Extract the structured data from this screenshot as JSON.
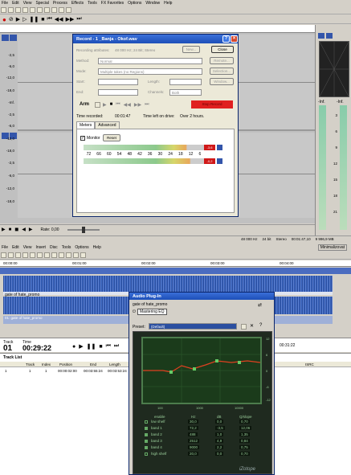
{
  "top": {
    "menu": [
      "File",
      "Edit",
      "View",
      "Special",
      "Process",
      "Effects",
      "Tools",
      "FX Favorites",
      "Options",
      "Window",
      "Help"
    ]
  },
  "scale_top": [
    "-2,5",
    "-6,0",
    "-12,0",
    "-18,0",
    "-Inf.",
    "-2,5",
    "-6,0",
    "-12,0",
    "-18,0",
    "-2,5",
    "-6,0",
    "-12,0",
    "-18,0"
  ],
  "meter_right": {
    "left": "-Inf.",
    "right": "-Inf.",
    "ticks": [
      "3",
      "6",
      "9",
      "12",
      "15",
      "18",
      "21"
    ]
  },
  "record": {
    "title": "Record - 1 _Banja - Okof.wav",
    "attrs_label": "Recording attributes:",
    "attrs_value": "48 000 Hz; 24 Bit; Stereo",
    "new": "New...",
    "close": "Close",
    "method_label": "Method:",
    "method": "Normal",
    "remote": "Remote...",
    "mode_label": "Mode:",
    "mode": "Multiple takes (no Regions)",
    "selection": "Selection...",
    "start_label": "Start:",
    "length_label": "Length:",
    "end_label": "End:",
    "channels_label": "Channels:",
    "channels": "Both",
    "window": "Window...",
    "arm": "Arm",
    "rec_label": "Stop Record",
    "time_recorded_label": "Time recorded:",
    "time_recorded": "00:01:47",
    "time_left_label": "Time left on drive:",
    "time_left": "Over 2 hours.",
    "tab_meters": "Meters",
    "tab_advanced": "Advanced",
    "monitor": "Monitor",
    "reset": "Reset",
    "meter_scale": [
      "72",
      "66",
      "60",
      "54",
      "48",
      "42",
      "36",
      "30",
      "24",
      "18",
      "12",
      "6"
    ],
    "peak_l": "-3,6",
    "peak_r": "-0,2"
  },
  "rate": {
    "label": "Rate: 0,00"
  },
  "status": {
    "hz": "48 000 Hz",
    "bits": "24 bit",
    "ch": "Stereo",
    "time": "00:01:47,10",
    "size": "9 996,9 MB"
  },
  "bottom": {
    "menu": [
      "File",
      "Edit",
      "View",
      "Insert",
      "Disc",
      "Tools",
      "Options",
      "Help"
    ],
    "minimalize": "Minimalizovat",
    "ruler": [
      "00:00:00",
      "00:01:00",
      "00:02:00",
      "00:03:00",
      "00:04:00"
    ],
    "track_name": "gate of hate_promo",
    "time_track": "01",
    "time_label_track": "Track",
    "time_label_time": "Time",
    "time_value": "00:29:22",
    "end_time": "00:31:22",
    "track_list": "Track List",
    "columns": [
      "",
      "Track",
      "Index",
      "Position",
      "End",
      "Length",
      "ISRC"
    ],
    "rows": [
      [
        "1",
        "1",
        "1",
        "00:00:02:00",
        "00:03:55:24",
        "00:03:53:24"
      ]
    ],
    "track_caption": "01: gate of hate_promo"
  },
  "plugin": {
    "title": "Audio Plug-In",
    "track": "gate of hate_promo",
    "chain": "Mastering EQ",
    "preset_label": "Preset:",
    "preset": "(Default)",
    "axis_bottom": [
      "100",
      "1000",
      "10000"
    ],
    "axis_right": [
      "12",
      "6",
      "0",
      "-6",
      "-12"
    ],
    "table_head": [
      "enable",
      "Hz",
      "dB",
      "Q/slope"
    ],
    "bands": [
      [
        "low shelf",
        "30,0",
        "0,0",
        "0,70"
      ],
      [
        "band 1",
        "72,2",
        "-3,5",
        "12,06"
      ],
      [
        "band 2",
        "488",
        "1,0",
        "1,35"
      ],
      [
        "band 3",
        "2512",
        "4,9",
        "0,84"
      ],
      [
        "band 4",
        "9000",
        "2,2",
        "0,75"
      ],
      [
        "high shelf",
        "20,0",
        "0,0",
        "0,70"
      ]
    ],
    "logo": "iZotope"
  }
}
